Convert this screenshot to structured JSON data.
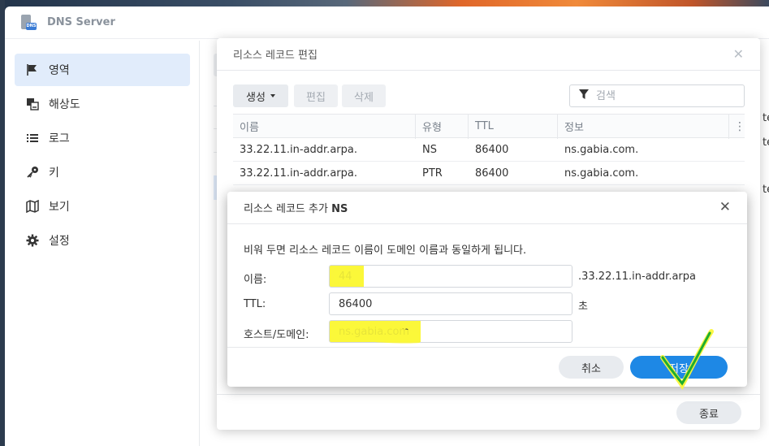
{
  "app": {
    "title": "DNS Server",
    "icon": "dns-server-app-icon"
  },
  "sidebar": {
    "items": [
      {
        "label": "영역",
        "icon": "flag-icon",
        "active": true
      },
      {
        "label": "해상도",
        "icon": "resolution-icon",
        "active": false
      },
      {
        "label": "로그",
        "icon": "list-icon",
        "active": false
      },
      {
        "label": "키",
        "icon": "key-icon",
        "active": false
      },
      {
        "label": "보기",
        "icon": "map-icon",
        "active": false
      },
      {
        "label": "설정",
        "icon": "gear-icon",
        "active": false
      }
    ]
  },
  "right_pane": {
    "cut_text": "te"
  },
  "edit_dialog": {
    "title": "리소스 레코드 편집",
    "close_icon": "close-icon",
    "toolbar": {
      "create": "생성",
      "edit": "편집",
      "delete": "삭제"
    },
    "search": {
      "placeholder": "검색",
      "icon": "filter-icon"
    },
    "columns": [
      "이름",
      "유형",
      "TTL",
      "정보"
    ],
    "rows": [
      {
        "name": "33.22.11.in-addr.arpa.",
        "type": "NS",
        "ttl": "86400",
        "info": "ns.gabia.com."
      },
      {
        "name": "33.22.11.in-addr.arpa.",
        "type": "PTR",
        "ttl": "86400",
        "info": "ns.gabia.com."
      }
    ],
    "close_button": "종료"
  },
  "add_dialog": {
    "title_prefix": "리소스 레코드 추가",
    "title_type": "NS",
    "description": "비워 두면 리소스 레코드 이름이 도메인 이름과 동일하게 됩니다.",
    "fields": {
      "name": {
        "label": "이름:",
        "value": "44",
        "suffix": ".33.22.11.in-addr.arpa"
      },
      "ttl": {
        "label": "TTL:",
        "value": "86400",
        "suffix": "초"
      },
      "host": {
        "label": "호스트/도메인:",
        "value": "ns.gabia.com"
      }
    },
    "cancel": "취소",
    "save": "저장"
  },
  "colors": {
    "accent": "#1e88e5",
    "highlight": "#fbf73a",
    "annotation_green": "#1fae2e",
    "selected_nav": "#e1ecfb"
  }
}
